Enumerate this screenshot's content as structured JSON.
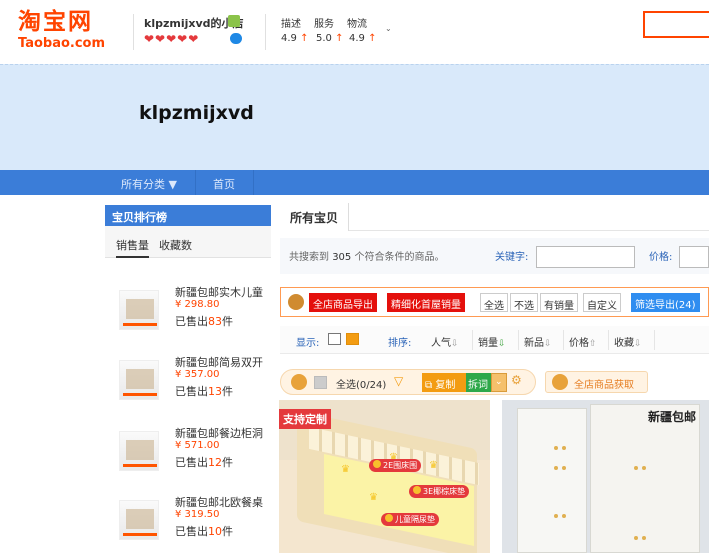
{
  "header": {
    "logo_cn": "淘宝网",
    "logo_en": "Taobao.com",
    "shop_name": "klpzmijxvd的小店",
    "hearts": "❤❤❤❤❤",
    "dsr_labels": [
      "描述",
      "服务",
      "物流"
    ],
    "dsr_values": [
      "4.9",
      "5.0",
      "4.9"
    ],
    "dsr_arrow": "↑",
    "dropdown_glyph": "⌄"
  },
  "banner": {
    "title": "klpzmijxvd"
  },
  "nav": {
    "items": [
      "所有分类 ▼",
      "首页"
    ]
  },
  "ranking": {
    "title": "宝贝排行榜",
    "tabs": [
      "销售量",
      "收藏数"
    ],
    "items": [
      {
        "title": "新疆包邮实木儿童",
        "price": "¥ 298.80",
        "sold_prefix": "已售出",
        "sold": "83",
        "sold_suffix": "件"
      },
      {
        "title": "新疆包邮简易双开",
        "price": "¥ 357.00",
        "sold_prefix": "已售出",
        "sold": "13",
        "sold_suffix": "件"
      },
      {
        "title": "新疆包邮餐边柜洞",
        "price": "¥ 571.00",
        "sold_prefix": "已售出",
        "sold": "12",
        "sold_suffix": "件"
      },
      {
        "title": "新疆包邮北欧餐桌",
        "price": "¥ 319.50",
        "sold_prefix": "已售出",
        "sold": "10",
        "sold_suffix": "件"
      }
    ]
  },
  "main": {
    "tab": "所有宝贝",
    "total_prefix": "共搜索到 ",
    "total": "305",
    "total_suffix": " 个符合条件的商品。",
    "keyword_label": "关键字:",
    "price_label": "价格:",
    "toolbar": {
      "export_all": "全店商品导出",
      "export_top": "精细化首屋销量",
      "select_all": "全选",
      "select_none": "不选",
      "with_sales": "有销量",
      "custom": "自定义",
      "filter_export": "筛选导出(24)"
    },
    "sort": {
      "display_label": "显示:",
      "sort_label": "排序:",
      "options": [
        "人气",
        "销量",
        "新品",
        "价格",
        "收藏"
      ],
      "arrows": [
        "⇩",
        "⇩",
        "⇩",
        "⇧",
        "⇩"
      ]
    },
    "selection": {
      "select_all_count": "全选(0/24)",
      "copy": "复制",
      "split": "拆词",
      "get_all": "全店商品获取"
    },
    "products": [
      {
        "badge": "支持定制",
        "tags": [
          "2E围床围",
          "3E椰棕床垫",
          "儿童隔尿垫"
        ]
      },
      {
        "title": "新疆包邮"
      }
    ]
  },
  "colors": {
    "brand": "#ff4400",
    "nav": "#3b7dd8",
    "banner": "#d9e9fa",
    "accent_orange": "#f39c12",
    "red": "#e4100c"
  }
}
